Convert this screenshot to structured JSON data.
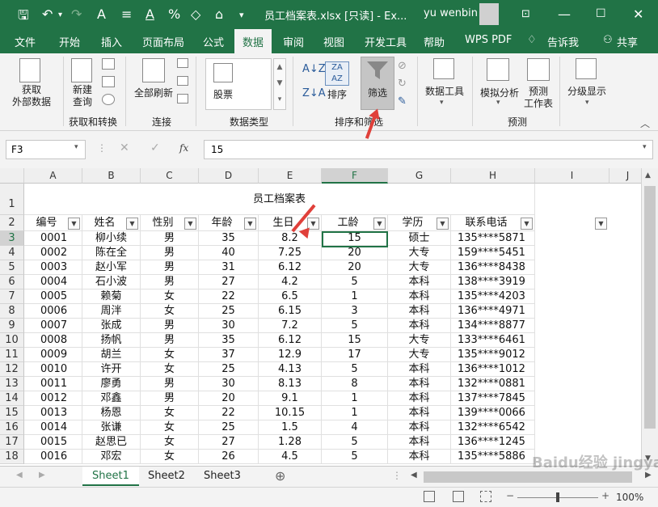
{
  "window": {
    "title": "员工档案表.xlsx [只读] - Ex...",
    "user": "yu wenbin"
  },
  "menu_tabs": [
    "文件",
    "开始",
    "插入",
    "页面布局",
    "公式",
    "数据",
    "审阅",
    "视图",
    "开发工具",
    "帮助",
    "WPS PDF",
    "告诉我",
    "共享"
  ],
  "active_tab": "数据",
  "ribbon": {
    "get_external_data": "获取\n外部数据",
    "new_query": "新建\n查询",
    "refresh_all": "全部刷新",
    "stocks": "股票",
    "sort": "排序",
    "filter": "筛选",
    "data_tools": "数据工具",
    "what_if": "模拟分析",
    "forecast": "预测\n工作表",
    "outline": "分级显示",
    "groups": [
      "获取和转换",
      "连接",
      "数据类型",
      "排序和筛选",
      "预测"
    ]
  },
  "formula_bar": {
    "name_box": "F3",
    "formula": "15",
    "fx": "fx"
  },
  "columns": [
    "A",
    "B",
    "C",
    "D",
    "E",
    "F",
    "G",
    "H",
    "I",
    "J"
  ],
  "sheet_title": "员工档案表",
  "headers": [
    "编号",
    "姓名",
    "性别",
    "年龄",
    "生日",
    "工龄",
    "学历",
    "联系电话"
  ],
  "rows": [
    [
      "0001",
      "柳小续",
      "男",
      "35",
      "8.2",
      "15",
      "硕士",
      "135****5871"
    ],
    [
      "0002",
      "陈在全",
      "男",
      "40",
      "7.25",
      "20",
      "大专",
      "159****5451"
    ],
    [
      "0003",
      "赵小军",
      "男",
      "31",
      "6.12",
      "20",
      "大专",
      "136****8438"
    ],
    [
      "0004",
      "石小波",
      "男",
      "27",
      "4.2",
      "5",
      "本科",
      "138****3919"
    ],
    [
      "0005",
      "赖菊",
      "女",
      "22",
      "6.5",
      "1",
      "本科",
      "135****4203"
    ],
    [
      "0006",
      "周泮",
      "女",
      "25",
      "6.15",
      "3",
      "本科",
      "136****4971"
    ],
    [
      "0007",
      "张成",
      "男",
      "30",
      "7.2",
      "5",
      "本科",
      "134****8877"
    ],
    [
      "0008",
      "扬帆",
      "男",
      "35",
      "6.12",
      "15",
      "大专",
      "133****6461"
    ],
    [
      "0009",
      "胡兰",
      "女",
      "37",
      "12.9",
      "17",
      "大专",
      "135****9012"
    ],
    [
      "0010",
      "许开",
      "女",
      "25",
      "4.13",
      "5",
      "本科",
      "136****1012"
    ],
    [
      "0011",
      "廖勇",
      "男",
      "30",
      "8.13",
      "8",
      "本科",
      "132****0881"
    ],
    [
      "0012",
      "邓鑫",
      "男",
      "20",
      "9.1",
      "1",
      "本科",
      "137****7845"
    ],
    [
      "0013",
      "杨恩",
      "女",
      "22",
      "10.15",
      "1",
      "本科",
      "139****0066"
    ],
    [
      "0014",
      "张谦",
      "女",
      "25",
      "1.5",
      "4",
      "本科",
      "132****6542"
    ],
    [
      "0015",
      "赵思已",
      "女",
      "27",
      "1.28",
      "5",
      "本科",
      "136****1245"
    ],
    [
      "0016",
      "邓宏",
      "女",
      "26",
      "4.5",
      "5",
      "本科",
      "135****5886"
    ]
  ],
  "row_numbers": [
    "1",
    "2",
    "3",
    "4",
    "5",
    "6",
    "7",
    "8",
    "9",
    "10",
    "11",
    "12",
    "13",
    "14",
    "15",
    "16",
    "17",
    "18"
  ],
  "sheets": [
    "Sheet1",
    "Sheet2",
    "Sheet3"
  ],
  "active_sheet": "Sheet1",
  "zoom": "100%",
  "watermark": "Baidu经验 jingyan.baidu.com"
}
